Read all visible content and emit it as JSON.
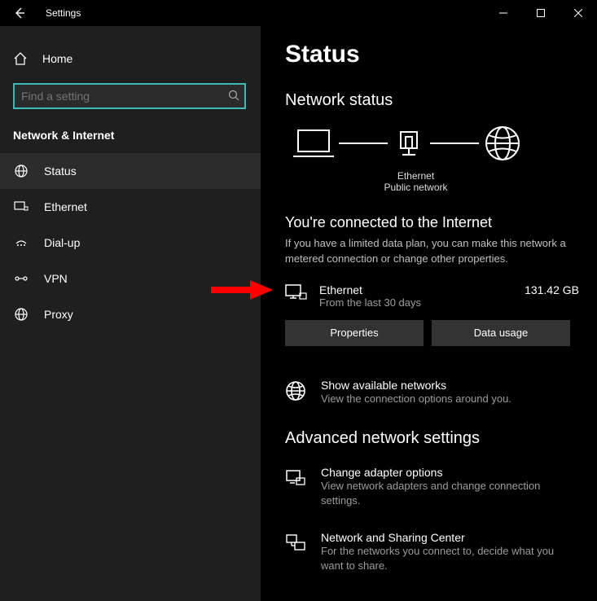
{
  "titlebar": {
    "title": "Settings"
  },
  "sidebar": {
    "home_label": "Home",
    "search_placeholder": "Find a setting",
    "category": "Network & Internet",
    "items": [
      {
        "label": "Status"
      },
      {
        "label": "Ethernet"
      },
      {
        "label": "Dial-up"
      },
      {
        "label": "VPN"
      },
      {
        "label": "Proxy"
      }
    ]
  },
  "main": {
    "page_title": "Status",
    "section_title": "Network status",
    "diagram": {
      "mid_label": "Ethernet",
      "mid_sub": "Public network"
    },
    "headline": "You're connected to the Internet",
    "description": "If you have a limited data plan, you can make this network a metered connection or change other properties.",
    "connection": {
      "name": "Ethernet",
      "sub": "From the last 30 days",
      "usage": "131.42 GB"
    },
    "properties_btn": "Properties",
    "data_usage_btn": "Data usage",
    "available": {
      "title": "Show available networks",
      "sub": "View the connection options around you."
    },
    "advanced_title": "Advanced network settings",
    "adapter": {
      "title": "Change adapter options",
      "sub": "View network adapters and change connection settings."
    },
    "sharing": {
      "title": "Network and Sharing Center",
      "sub": "For the networks you connect to, decide what you want to share."
    }
  }
}
